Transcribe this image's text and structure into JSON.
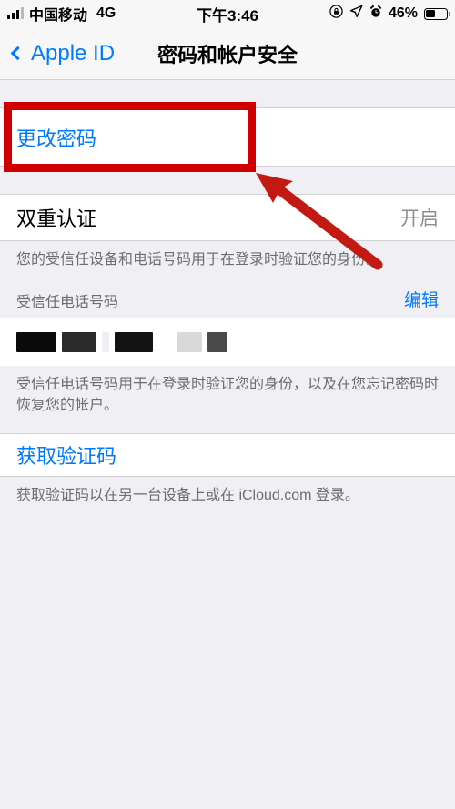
{
  "status_bar": {
    "carrier": "中国移动",
    "network_type": "4G",
    "time": "下午3:46",
    "battery_percent": "46%",
    "battery_level": 46,
    "icons": [
      "signal-bars-icon",
      "rotation-lock-icon",
      "location-arrow-icon",
      "alarm-clock-icon",
      "battery-icon"
    ]
  },
  "nav_bar": {
    "back_label": "Apple ID",
    "title": "密码和帐户安全"
  },
  "sections": {
    "change_password": {
      "label": "更改密码"
    },
    "two_factor": {
      "title": "双重认证",
      "value": "开启",
      "footer": "您的受信任设备和电话号码用于在登录时验证您的身份。"
    },
    "trusted_phone": {
      "header": "受信任电话号码",
      "action": "编辑",
      "number_redacted": true,
      "footer": "受信任电话号码用于在登录时验证您的身份，以及在您忘记密码时恢复您的帐户。"
    },
    "verification_code": {
      "label": "获取验证码",
      "footer": "获取验证码以在另一台设备上或在 iCloud.com 登录。"
    }
  },
  "annotations": {
    "highlight_box_color": "#D00000",
    "arrow_color": "#C21A13",
    "highlight_target": "更改密码"
  },
  "colors": {
    "accent_blue": "#007AFF",
    "group_background": "#EFEFF4",
    "cell_background": "#FFFFFF",
    "secondary_text": "#6D6D72",
    "value_text": "#8E8E93"
  }
}
